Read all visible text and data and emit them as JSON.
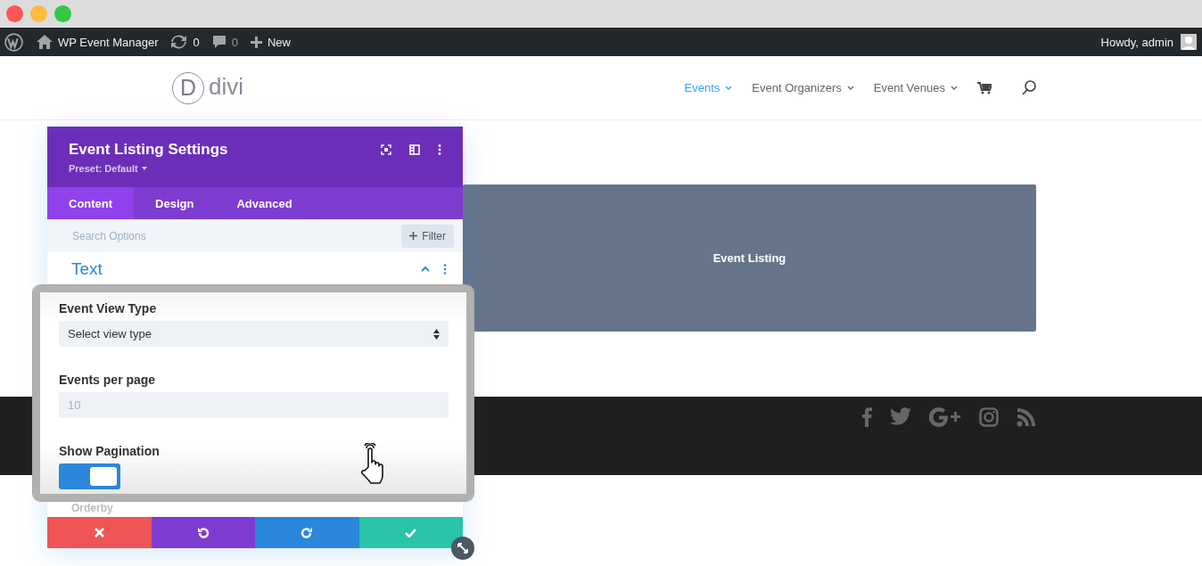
{
  "admin_bar": {
    "site_name": "WP Event Manager",
    "updates_count": "0",
    "comments_count": "0",
    "new_label": "New",
    "greeting": "Howdy, admin"
  },
  "header": {
    "logo_mark": "D",
    "logo_text": "divi",
    "nav": [
      {
        "label": "Events",
        "selected": true
      },
      {
        "label": "Event Organizers",
        "selected": false
      },
      {
        "label": "Event Venues",
        "selected": false
      }
    ]
  },
  "module": {
    "label": "Event Listing"
  },
  "settings_panel": {
    "title": "Event Listing Settings",
    "preset": "Preset: Default",
    "tabs": [
      {
        "label": "Content",
        "selected": true
      },
      {
        "label": "Design",
        "selected": false
      },
      {
        "label": "Advanced",
        "selected": false
      }
    ],
    "search": {
      "placeholder": "Search Options"
    },
    "filter_label": "Filter",
    "section_title": "Text",
    "fields": [
      {
        "kind": "select",
        "label": "Event View Type",
        "value": "Select view type"
      },
      {
        "kind": "number",
        "label": "Events per page",
        "placeholder": "10"
      },
      {
        "kind": "toggle",
        "label": "Show Pagination",
        "on": true
      }
    ],
    "peek_label": "Orderby"
  }
}
